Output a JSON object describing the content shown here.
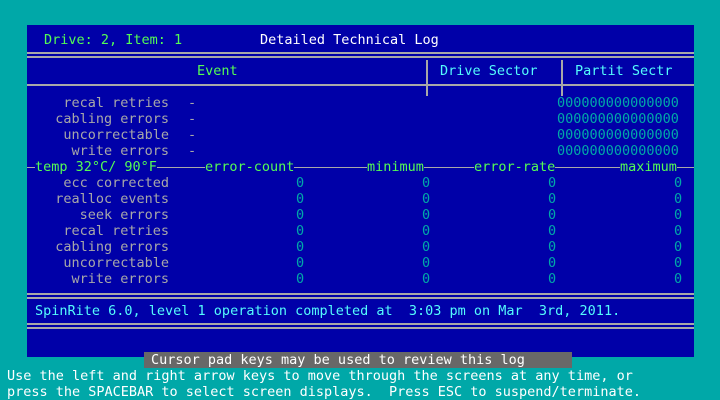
{
  "header": {
    "drive_label": "Drive: 2, Item: 1",
    "title": "Detailed Technical Log"
  },
  "columns": {
    "event": "Event",
    "drive_sector": "Drive Sector",
    "partit_sectr": "Partit Sectr"
  },
  "sector_rows": [
    {
      "label": "recal retries",
      "dash": "-",
      "value": "000000000000000"
    },
    {
      "label": "cabling errors",
      "dash": "-",
      "value": "000000000000000"
    },
    {
      "label": "uncorrectable",
      "dash": "-",
      "value": "000000000000000"
    },
    {
      "label": "write errors",
      "dash": "-",
      "value": "000000000000000"
    }
  ],
  "stats_header": {
    "temp": "temp 32°C/ 90°F",
    "error_count": "error-count",
    "minimum": "minimum",
    "error_rate": "error-rate",
    "maximum": "maximum"
  },
  "stats_rows": [
    {
      "label": "ecc corrected",
      "error_count": "0",
      "minimum": "0",
      "error_rate": "0",
      "maximum": "0"
    },
    {
      "label": "realloc events",
      "error_count": "0",
      "minimum": "0",
      "error_rate": "0",
      "maximum": "0"
    },
    {
      "label": "seek errors",
      "error_count": "0",
      "minimum": "0",
      "error_rate": "0",
      "maximum": "0"
    },
    {
      "label": "recal retries",
      "error_count": "0",
      "minimum": "0",
      "error_rate": "0",
      "maximum": "0"
    },
    {
      "label": "cabling errors",
      "error_count": "0",
      "minimum": "0",
      "error_rate": "0",
      "maximum": "0"
    },
    {
      "label": "uncorrectable",
      "error_count": "0",
      "minimum": "0",
      "error_rate": "0",
      "maximum": "0"
    },
    {
      "label": "write errors",
      "error_count": "0",
      "minimum": "0",
      "error_rate": "0",
      "maximum": "0"
    }
  ],
  "completion_message": "SpinRite 6.0, level 1 operation completed at  3:03 pm on Mar  3rd, 2011.",
  "status_bar": "Cursor pad keys may be used to review this log",
  "help_lines": [
    "Use the left and right arrow keys to move through the screens at any time, or",
    "press the SPACEBAR to select screen displays.  Press ESC to suspend/terminate."
  ]
}
